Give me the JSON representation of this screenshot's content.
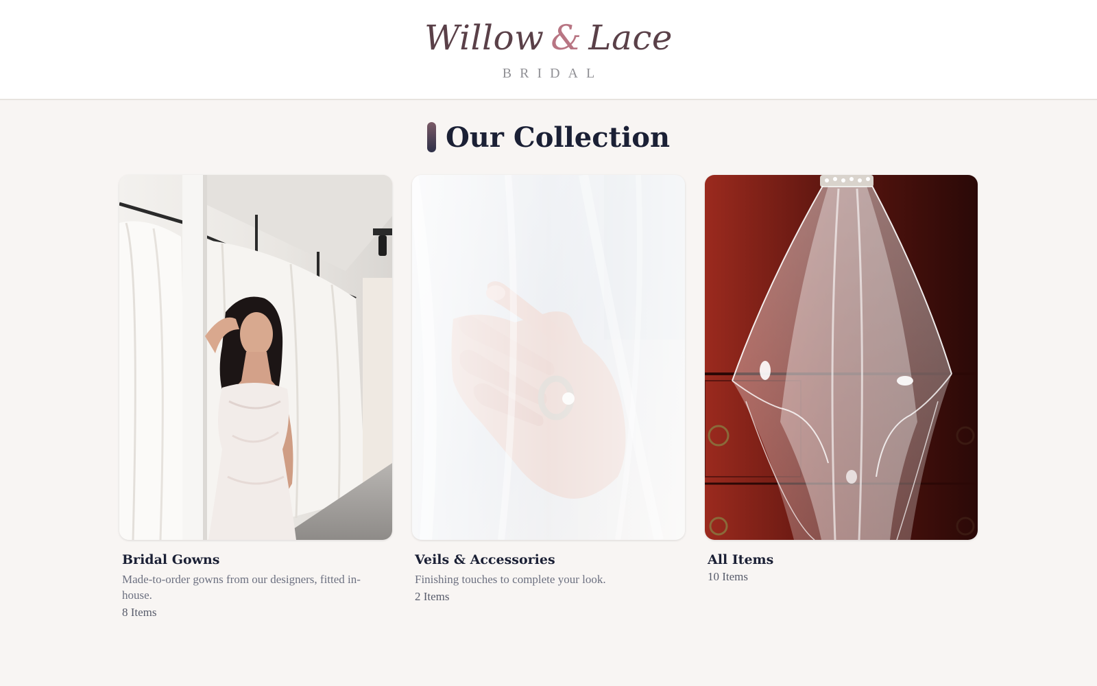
{
  "header": {
    "brand_left": "Willow",
    "brand_amp": "&",
    "brand_right": "Lace",
    "tagline": "BRIDAL"
  },
  "section": {
    "title": "Our Collection"
  },
  "collections": [
    {
      "name": "Bridal Gowns",
      "description": "Made-to-order gowns from our designers, fitted in-house.",
      "count": "8 Items"
    },
    {
      "name": "Veils & Accessories",
      "description": "Finishing touches to complete your look.",
      "count": "2 Items"
    },
    {
      "name": "All Items",
      "description": "",
      "count": "10 Items"
    }
  ],
  "colors": {
    "page_background": "#f8f5f3",
    "brand": "#5a4048",
    "brand_accent": "#b87583",
    "heading": "#1b2035"
  }
}
